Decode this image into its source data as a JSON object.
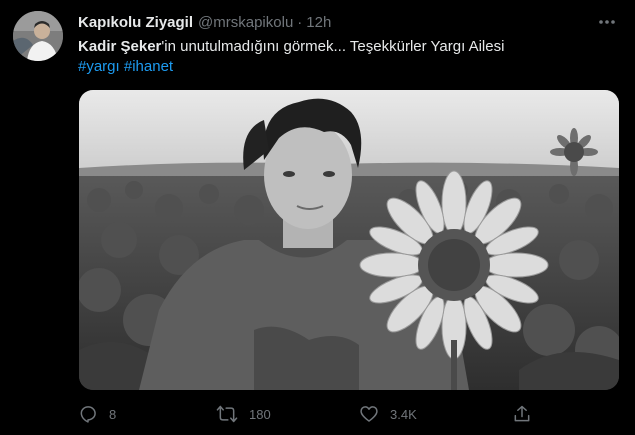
{
  "tweet": {
    "display_name": "Kapıkolu Ziyagil",
    "handle": "@mrskapikolu",
    "separator": "·",
    "time": "12h",
    "text": {
      "mention": "Kadir Şeker",
      "body": "'in unutulmadığını görmek... Teşekkürler Yargı Ailesi",
      "hashtags": [
        "#yargı",
        "#ihanet"
      ]
    },
    "actions": {
      "reply_count": "8",
      "retweet_count": "180",
      "like_count": "3.4K"
    },
    "icons": {
      "more": "more-horizontal-icon",
      "reply": "reply-icon",
      "retweet": "retweet-icon",
      "like": "heart-icon",
      "share": "share-icon"
    }
  },
  "colors": {
    "background": "#000000",
    "text_primary": "#e7e9ea",
    "text_secondary": "#71767b",
    "link": "#1d9bf0"
  }
}
